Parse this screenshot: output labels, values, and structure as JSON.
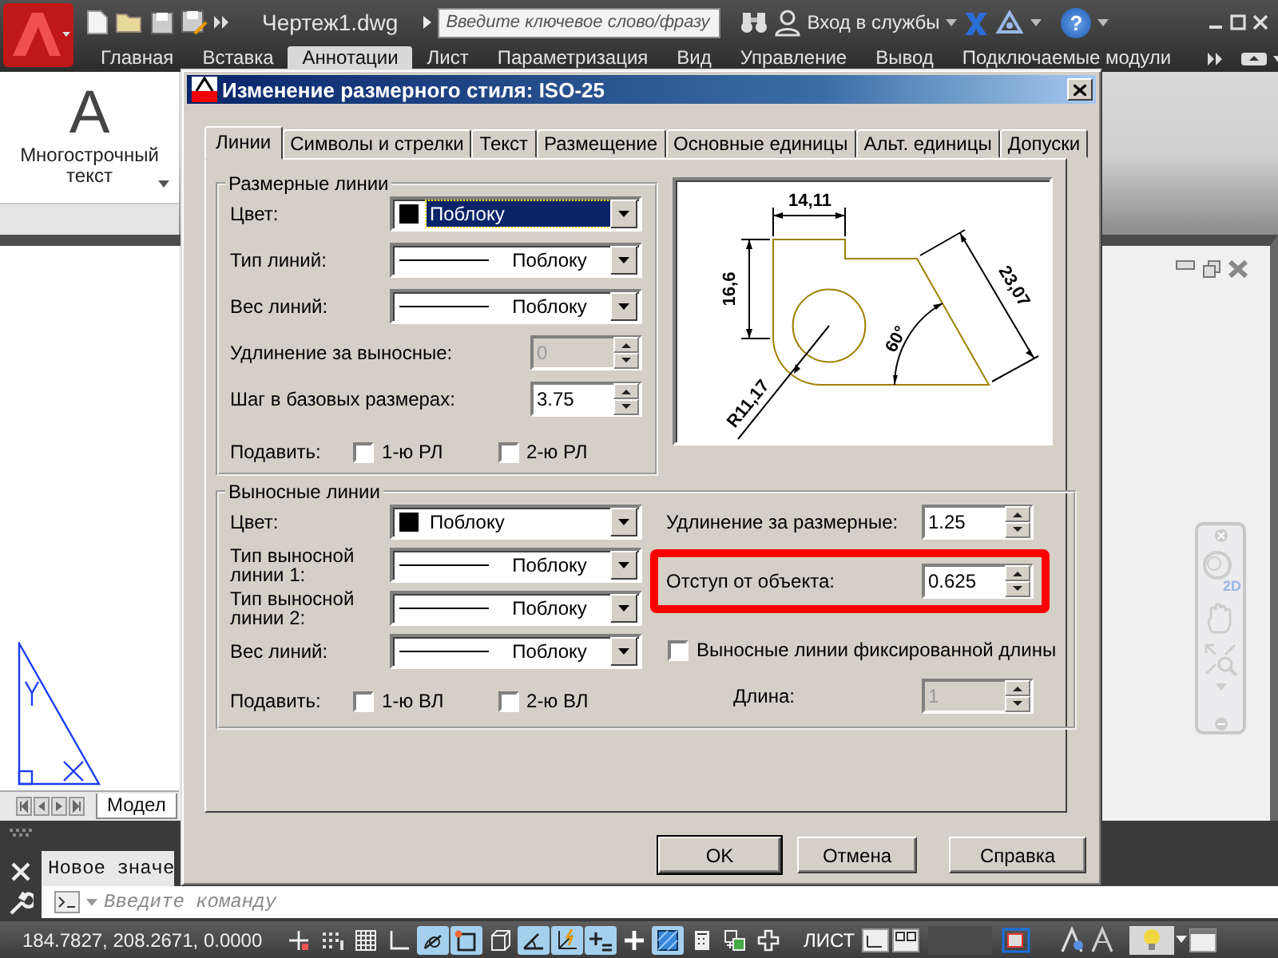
{
  "app": {
    "title": "Чертеж1.dwg",
    "search": {
      "placeholder": "Введите ключевое слово/фразу"
    },
    "sign_in": "Вход в службы",
    "help": "?"
  },
  "ribbon": {
    "tabs": [
      {
        "label": "Главная",
        "selected": false
      },
      {
        "label": "Вставка",
        "selected": false
      },
      {
        "label": "Аннотации",
        "selected": true
      },
      {
        "label": "Лист",
        "selected": false
      },
      {
        "label": "Параметризация",
        "selected": false
      },
      {
        "label": "Вид",
        "selected": false
      },
      {
        "label": "Управление",
        "selected": false
      },
      {
        "label": "Вывод",
        "selected": false
      },
      {
        "label": "Подключаемые модули",
        "selected": false
      }
    ],
    "tool": {
      "glyph": "A",
      "label": "Многострочный текст"
    }
  },
  "model_tab": "Модел",
  "nav_bar": {
    "wheel_label": "2D"
  },
  "command_line": {
    "history": "Новое значе",
    "placeholder": "Введите команду"
  },
  "status_bar": {
    "coordinates": "184.7827, 208.2671, 0.0000",
    "toggles": [
      {
        "kind": "snap",
        "on": false
      },
      {
        "kind": "dots",
        "on": false
      },
      {
        "kind": "grid",
        "on": false
      },
      {
        "kind": "ortho",
        "on": false
      },
      {
        "kind": "polar",
        "on": true
      },
      {
        "kind": "osnap",
        "on": true
      },
      {
        "kind": "cube",
        "on": false
      },
      {
        "kind": "angle",
        "on": true
      },
      {
        "kind": "axes",
        "on": true
      },
      {
        "kind": "dyn",
        "on": true
      },
      {
        "kind": "plus",
        "on": false
      },
      {
        "kind": "hatch",
        "on": true
      },
      {
        "kind": "calc",
        "on": false
      },
      {
        "kind": "cycle",
        "on": false
      },
      {
        "kind": "cross",
        "on": false
      }
    ],
    "layout_label": "ЛИСТ"
  },
  "dialog": {
    "title": "Изменение размерного стиля: ISO-25",
    "tabs": [
      {
        "label": "Линии",
        "selected": true
      },
      {
        "label": "Символы и стрелки",
        "selected": false
      },
      {
        "label": "Текст",
        "selected": false
      },
      {
        "label": "Размещение",
        "selected": false
      },
      {
        "label": "Основные единицы",
        "selected": false
      },
      {
        "label": "Альт. единицы",
        "selected": false
      },
      {
        "label": "Допуски",
        "selected": false
      }
    ],
    "dimension_lines": {
      "title": "Размерные линии",
      "fields": [
        {
          "kind": "color",
          "label": "Цвет:",
          "value": "Поблоку",
          "focused": true
        },
        {
          "kind": "linetype",
          "label": "Тип линий:",
          "value": "Поблоку",
          "focused": false
        },
        {
          "kind": "linetype",
          "label": "Вес линий:",
          "value": "Поблоку",
          "focused": false
        },
        {
          "kind": "number",
          "label": "Удлинение за выносные:",
          "value": "0",
          "disabled": true
        },
        {
          "kind": "number",
          "label": "Шаг в базовых размерах:",
          "value": "3.75",
          "disabled": false
        }
      ],
      "suppress": {
        "label": "Подавить:",
        "options": [
          {
            "label": "1-ю РЛ",
            "checked": false
          },
          {
            "label": "2-ю РЛ",
            "checked": false
          }
        ]
      }
    },
    "preview": {
      "labels": [
        "14,11",
        "16,6",
        "23,07",
        "60°",
        "R11,17"
      ]
    },
    "extension_lines": {
      "title": "Выносные линии",
      "fields": [
        {
          "kind": "color",
          "label": "Цвет:",
          "value": "Поблоку",
          "focused": false
        },
        {
          "kind": "linetype",
          "label": "Тип выносной линии 1:",
          "value": "Поблоку",
          "focused": false
        },
        {
          "kind": "linetype",
          "label": "Тип выносной линии 2:",
          "value": "Поблоку",
          "focused": false
        },
        {
          "kind": "linetype",
          "label": "Вес линий:",
          "value": "Поблоку",
          "focused": false
        }
      ],
      "suppress": {
        "label": "Подавить:",
        "options": [
          {
            "label": "1-ю ВЛ",
            "checked": false
          },
          {
            "label": "2-ю ВЛ",
            "checked": false
          }
        ]
      },
      "settings": [
        {
          "label": "Удлинение за размерные:",
          "value": "1.25",
          "disabled": false,
          "highlighted": false
        },
        {
          "label": "Отступ от объекта:",
          "value": "0.625",
          "disabled": false,
          "highlighted": true
        }
      ],
      "fixed_length": {
        "label": "Выносные линии фиксированной длины",
        "checked": false
      },
      "length": {
        "label": "Длина:",
        "value": "1",
        "disabled": true
      }
    },
    "buttons": [
      "OK",
      "Отмена",
      "Справка"
    ]
  }
}
